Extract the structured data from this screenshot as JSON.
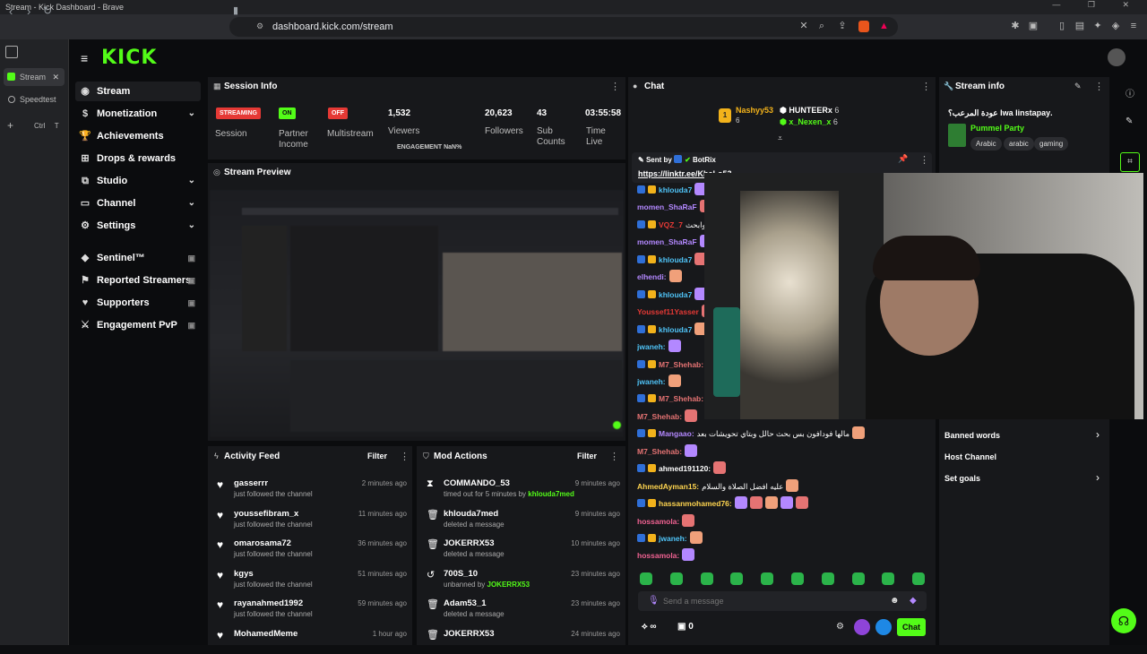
{
  "browser": {
    "window_title": "Stream - Kick Dashboard - Brave",
    "url": "dashboard.kick.com/stream",
    "tabs": [
      {
        "label": "Stream"
      },
      {
        "label": "Speedtest"
      }
    ],
    "shortcut": "Ctrl",
    "shortcut_key": "T"
  },
  "brand": {
    "logo": "KICK",
    "accent": "#53fc18"
  },
  "sidebar": {
    "items": [
      {
        "label": "Stream",
        "icon": "radio-icon",
        "active": true
      },
      {
        "label": "Monetization",
        "icon": "dollar-icon",
        "chevron": true
      },
      {
        "label": "Achievements",
        "icon": "trophy-icon"
      },
      {
        "label": "Drops & rewards",
        "icon": "gift-icon"
      },
      {
        "label": "Studio",
        "icon": "studio-icon",
        "chevron": true
      },
      {
        "label": "Channel",
        "icon": "channel-icon",
        "chevron": true
      },
      {
        "label": "Settings",
        "icon": "gear-icon",
        "chevron": true
      },
      {
        "label": "Sentinel™",
        "icon": "sentinel-icon",
        "locked": true
      },
      {
        "label": "Reported Streamers",
        "icon": "flag-icon",
        "locked": true
      },
      {
        "label": "Supporters",
        "icon": "users-icon",
        "locked": true
      },
      {
        "label": "Engagement PvP",
        "icon": "pvp-icon",
        "locked": true
      }
    ]
  },
  "session": {
    "title": "Session Info",
    "stats": [
      {
        "badge": "STREAMING",
        "badge_color": "#e53935",
        "label": "Session"
      },
      {
        "badge": "ON",
        "badge_color": "#53fc18",
        "label": "Partner Income"
      },
      {
        "badge": "OFF",
        "badge_color": "#e53935",
        "label": "Multistream"
      }
    ],
    "numbers": [
      {
        "value": "1,532",
        "label": "Viewers"
      },
      {
        "value": "20,623",
        "label": "Followers"
      },
      {
        "value": "43",
        "label": "Sub Counts"
      },
      {
        "value": "03:55:58",
        "label": "Time Live"
      }
    ],
    "engagement": "ENGAGEMENT NaN%"
  },
  "preview": {
    "title": "Stream Preview"
  },
  "activity": {
    "title": "Activity Feed",
    "filter": "Filter",
    "rows": [
      {
        "name": "gasserrr",
        "sub": "just followed the channel",
        "time": "2 minutes ago"
      },
      {
        "name": "youssefibram_x",
        "sub": "just followed the channel",
        "time": "11 minutes ago"
      },
      {
        "name": "omarosama72",
        "sub": "just followed the channel",
        "time": "36 minutes ago"
      },
      {
        "name": "kgys",
        "sub": "just followed the channel",
        "time": "51 minutes ago"
      },
      {
        "name": "rayanahmed1992",
        "sub": "just followed the channel",
        "time": "59 minutes ago"
      },
      {
        "name": "MohamedMeme",
        "sub": "",
        "time": "1 hour ago"
      }
    ]
  },
  "mod": {
    "title": "Mod Actions",
    "filter": "Filter",
    "rows": [
      {
        "icon": "hourglass-icon",
        "name": "COMMANDO_53",
        "sub": "timed out for 5 minutes by",
        "by": "khlouda7med",
        "time": "9 minutes ago"
      },
      {
        "icon": "trash-icon",
        "name": "khlouda7med",
        "sub": "deleted a message",
        "by": "",
        "time": "9 minutes ago"
      },
      {
        "icon": "trash-icon",
        "name": "JOKERRX53",
        "sub": "deleted a message",
        "by": "",
        "time": "10 minutes ago"
      },
      {
        "icon": "undo-icon",
        "name": "700S_10",
        "sub": "unbanned by",
        "by": "JOKERRX53",
        "time": "23 minutes ago"
      },
      {
        "icon": "trash-icon",
        "name": "Adam53_1",
        "sub": "deleted a message",
        "by": "",
        "time": "23 minutes ago"
      },
      {
        "icon": "trash-icon",
        "name": "JOKERRX53",
        "sub": "",
        "by": "",
        "time": "24 minutes ago"
      }
    ]
  },
  "chat": {
    "title": "Chat",
    "leaders": [
      {
        "name": "Nashyy53",
        "count": "6",
        "rank": "1"
      },
      {
        "name": "HUNTEERx",
        "count": "6"
      },
      {
        "name": "x_Nexen_x",
        "count": "6"
      }
    ],
    "pinned": {
      "sent_by": "Sent by",
      "bot": "BotRix",
      "link": "https://linktr.ee/KheLo53"
    },
    "messages": [
      {
        "user": "khlouda7",
        "color": "#4fc3f7",
        "text": ""
      },
      {
        "user": "momen_ShaRaF",
        "color": "#b388ff",
        "text": ""
      },
      {
        "user": "VQZ_7",
        "color": "#e53935",
        "text": "البنج اصبح وابحث :"
      },
      {
        "user": "momen_ShaRaF",
        "color": "#b388ff",
        "text": ""
      },
      {
        "user": "khlouda7",
        "color": "#4fc3f7",
        "text": ""
      },
      {
        "user": "elhendi:",
        "color": "#b388ff",
        "text": ""
      },
      {
        "user": "khlouda7",
        "color": "#4fc3f7",
        "text": ""
      },
      {
        "user": "Youssef11Yasser",
        "color": "#e53935",
        "text": ""
      },
      {
        "user": "khlouda7",
        "color": "#4fc3f7",
        "text": ""
      },
      {
        "user": "jwaneh:",
        "color": "#4fc3f7",
        "text": ""
      },
      {
        "user": "M7_Shehab:",
        "color": "#e57373",
        "text": ""
      },
      {
        "user": "jwaneh:",
        "color": "#4fc3f7",
        "text": ""
      },
      {
        "user": "M7_Shehab:",
        "color": "#e57373",
        "text": ""
      },
      {
        "user": "M7_Shehab:",
        "color": "#e57373",
        "text": ""
      },
      {
        "user": "Mangaao:",
        "color": "#b388ff",
        "text": "مالها فودافون بس بحث حالل وبتاي تحويشات بعد"
      },
      {
        "user": "M7_Shehab:",
        "color": "#e57373",
        "text": ""
      },
      {
        "user": "ahmed191120:",
        "color": "#fff",
        "text": ""
      },
      {
        "user": "AhmedAyman15:",
        "color": "#ffd54f",
        "text": "عليه افضل الصلاة والسلام"
      },
      {
        "user": "hassanmohamed76:",
        "color": "#ffd54f",
        "text": ""
      },
      {
        "user": "hossamola:",
        "color": "#f06292",
        "text": ""
      },
      {
        "user": "jwaneh:",
        "color": "#4fc3f7",
        "text": ""
      },
      {
        "user": "hossamola:",
        "color": "#f06292",
        "text": ""
      }
    ],
    "input_placeholder": "Send a message",
    "points": "∞",
    "count": "0",
    "send": "Chat"
  },
  "stream_info": {
    "title": "Stream info",
    "stream_title": ".lwa linstapay عودة المرعب؟",
    "category": "Pummel Party",
    "tags": [
      "Arabic",
      "arabic",
      "gaming"
    ]
  },
  "quick_links": [
    {
      "label": "Banned words",
      "chevron": true
    },
    {
      "label": "Host Channel"
    },
    {
      "label": "Set goals",
      "chevron": true
    }
  ]
}
